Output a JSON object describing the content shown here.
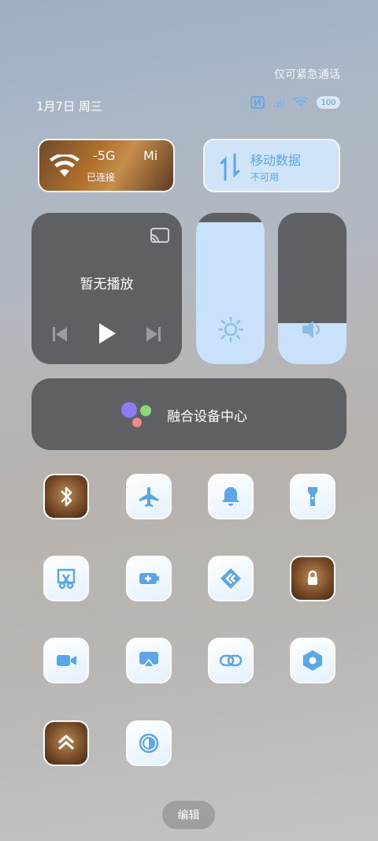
{
  "status": {
    "emergency_text": "仅可紧急通话",
    "datetime": "1月7日 周三",
    "battery": "100"
  },
  "wifi_tile": {
    "label": "-5G",
    "ssid": "Mi",
    "status": "已连接"
  },
  "mobile_tile": {
    "label": "移动数据",
    "status": "不可用"
  },
  "media": {
    "status": "暂无播放"
  },
  "fusion": {
    "label": "融合设备中心"
  },
  "edit_label": "编辑",
  "colors": {
    "accent": "#c9e2fb",
    "panel": "#5e6064",
    "icon": "#5aa6e6"
  },
  "tiles": [
    {
      "icon": "bluetooth-icon",
      "style": "photo"
    },
    {
      "icon": "airplane-icon",
      "style": "light"
    },
    {
      "icon": "bell-icon",
      "style": "light"
    },
    {
      "icon": "flashlight-icon",
      "style": "light"
    },
    {
      "icon": "screenshot-icon",
      "style": "light"
    },
    {
      "icon": "battery-saver-icon",
      "style": "light"
    },
    {
      "icon": "nearby-share-icon",
      "style": "light"
    },
    {
      "icon": "lock-rotation-icon",
      "style": "photo"
    },
    {
      "icon": "video-icon",
      "style": "light"
    },
    {
      "icon": "screen-cast-icon",
      "style": "light"
    },
    {
      "icon": "link-icon",
      "style": "light"
    },
    {
      "icon": "settings-hex-icon",
      "style": "light"
    },
    {
      "icon": "arrows-up-icon",
      "style": "photo"
    },
    {
      "icon": "dark-mode-icon",
      "style": "light"
    }
  ]
}
